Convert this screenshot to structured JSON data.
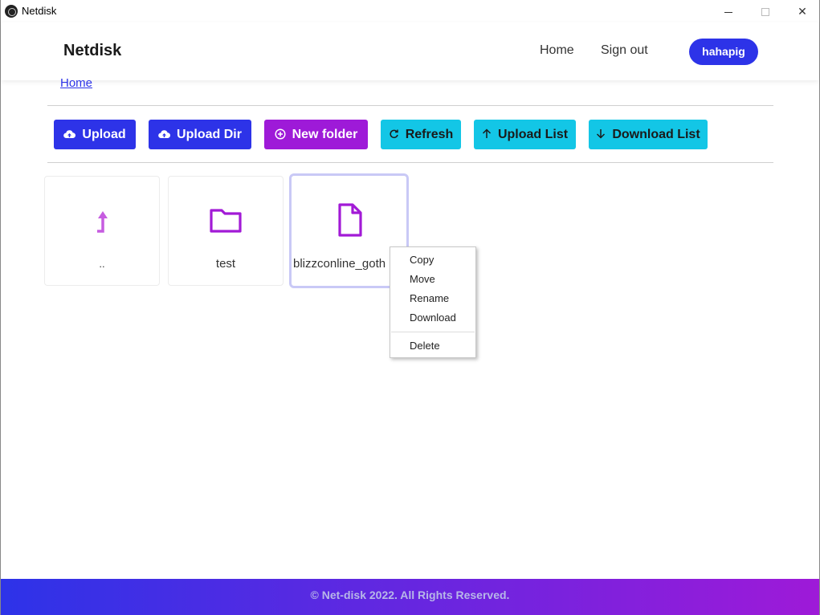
{
  "window": {
    "title": "Netdisk",
    "minimize_label": "minimize",
    "maximize_label": "maximize",
    "close_label": "✕"
  },
  "header": {
    "brand": "Netdisk",
    "nav": {
      "home": "Home",
      "sign_out": "Sign out"
    },
    "user": "hahapig"
  },
  "breadcrumb": {
    "home": "Home"
  },
  "toolbar": {
    "upload": {
      "label": "Upload",
      "icon": "cloud-upload-icon"
    },
    "upload_dir": {
      "label": "Upload Dir",
      "icon": "cloud-upload-icon"
    },
    "new_folder": {
      "label": "New folder",
      "icon": "plus-circle-icon"
    },
    "refresh": {
      "label": "Refresh",
      "icon": "refresh-icon"
    },
    "upload_list": {
      "label": "Upload List",
      "icon": "arrow-up-icon"
    },
    "download_list": {
      "label": "Download List",
      "icon": "arrow-down-icon"
    }
  },
  "files": [
    {
      "name": "..",
      "type": "parent",
      "icon": "level-up-icon"
    },
    {
      "name": "test",
      "type": "folder",
      "icon": "folder-icon"
    },
    {
      "name": "blizzconline_goth",
      "type": "file",
      "icon": "file-icon",
      "selected": true
    }
  ],
  "context_menu": {
    "copy": "Copy",
    "move": "Move",
    "rename": "Rename",
    "download": "Download",
    "delete": "Delete"
  },
  "footer": {
    "text": "© Net-disk 2022. All Rights Reserved."
  },
  "colors": {
    "primary_blue": "#2d33e8",
    "purple": "#9e1ad8",
    "cyan": "#13c6e6",
    "icon_purple": "#a21ad6",
    "icon_light_purple": "#c65ce0"
  }
}
